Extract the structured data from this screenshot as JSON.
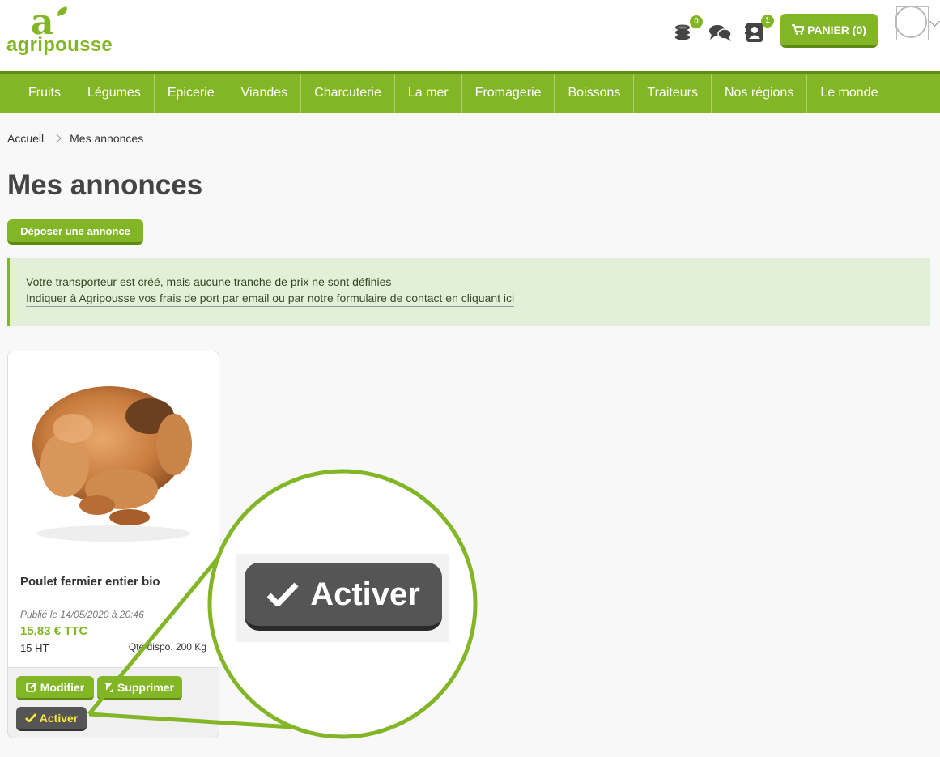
{
  "brand": {
    "name": "agripousse",
    "color": "#82b626"
  },
  "header": {
    "coins_badge": "0",
    "contacts_badge": "1",
    "cart_label": "PANIER (0)"
  },
  "nav": [
    "Fruits",
    "Légumes",
    "Epicerie",
    "Viandes",
    "Charcuterie",
    "La mer",
    "Fromagerie",
    "Boissons",
    "Traiteurs",
    "Nos régions",
    "Le monde"
  ],
  "breadcrumb": {
    "home": "Accueil",
    "current": "Mes annonces"
  },
  "page": {
    "title": "Mes annonces",
    "deposit_button": "Déposer une annonce"
  },
  "alert": {
    "line1": "Votre transporteur est créé, mais aucune tranche de prix ne sont définies",
    "line2": "Indiquer à Agripousse vos frais de port par email ou par notre formulaire de contact en cliquant ici"
  },
  "listing": {
    "title": "Poulet fermier entier bio",
    "published": "Publié le 14/05/2020 à 20:46",
    "price_ttc": "15,83 € TTC",
    "price_ht": "15 HT",
    "quantity": "Qté dispo. 200 Kg",
    "modify_button": "Modifier",
    "delete_button": "Supprimer",
    "activate_button": "Activer"
  },
  "zoom": {
    "button_label": "Activer"
  }
}
